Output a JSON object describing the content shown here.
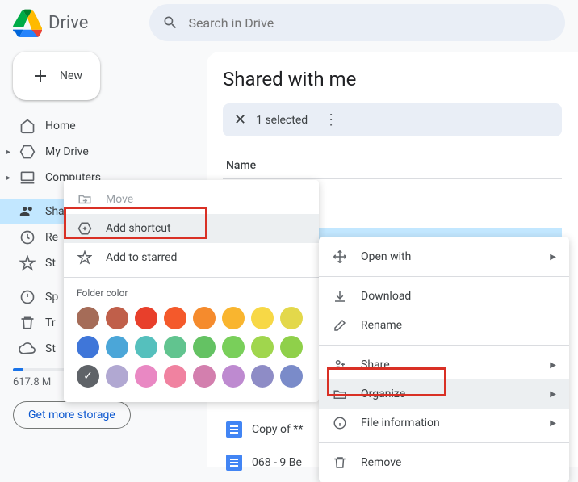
{
  "header": {
    "app_name": "Drive",
    "search_placeholder": "Search in Drive"
  },
  "sidebar": {
    "new_label": "New",
    "items": [
      "Home",
      "My Drive",
      "Computers",
      "Shared with me",
      "Recent",
      "Starred",
      "Spam",
      "Trash",
      "Storage"
    ],
    "storage_text": "617.8 M",
    "storage_btn": "Get more storage"
  },
  "content": {
    "title": "Shared with me",
    "selection_text": "1 selected",
    "name_header": "Name",
    "file_row": "Copy of **",
    "file_row2": "068 - 9 Be"
  },
  "submenu": {
    "move": "Move",
    "add_shortcut": "Add shortcut",
    "add_starred": "Add to starred",
    "folder_color_label": "Folder color",
    "colors": [
      "#a56c58",
      "#c05f4a",
      "#e83f2b",
      "#f4592b",
      "#f58b2d",
      "#f9b52f",
      "#f7d846",
      "#e3d84b",
      "#3f76d9",
      "#4ba6d8",
      "#55c0bd",
      "#61c48f",
      "#64c263",
      "#79cf5a",
      "#a0d64d",
      "#8fd04a",
      "#5f6368",
      "#b1a8d2",
      "#e988c3",
      "#f082a0",
      "#d37fae",
      "#be8ad0",
      "#8e8cc6",
      "#7a8bc9"
    ]
  },
  "ctxmenu": {
    "open_with": "Open with",
    "download": "Download",
    "rename": "Rename",
    "share": "Share",
    "organize": "Organize",
    "file_info": "File information",
    "remove": "Remove"
  }
}
